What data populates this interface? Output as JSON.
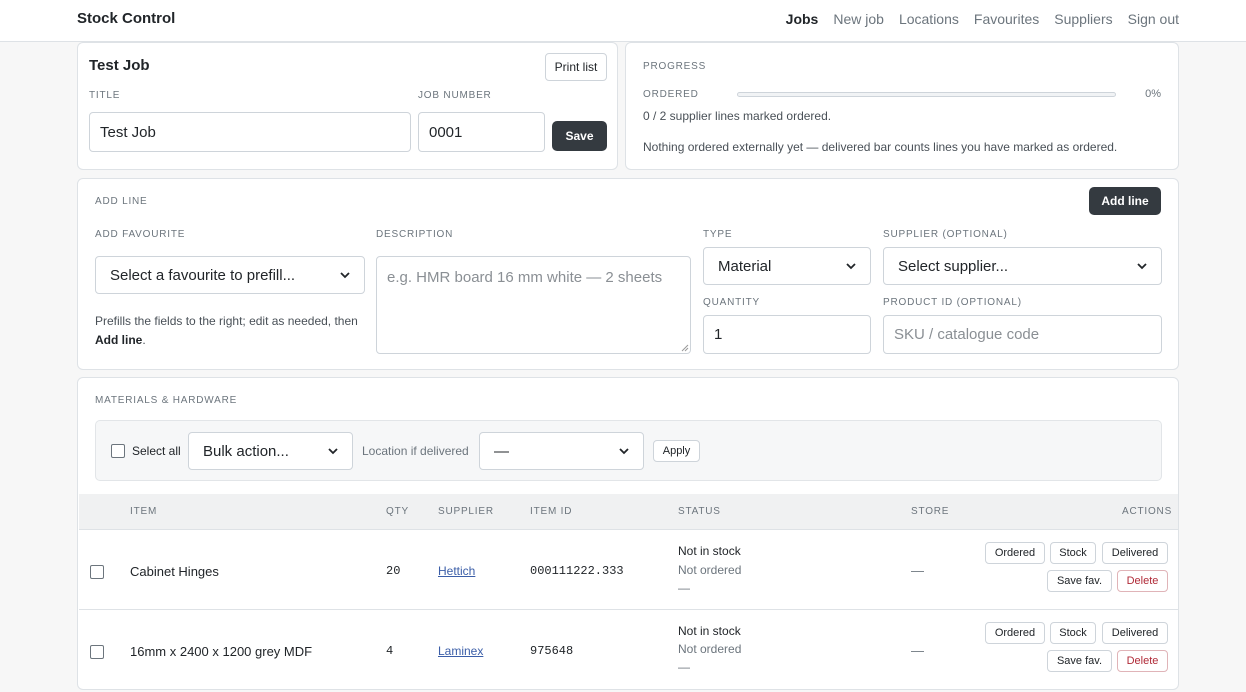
{
  "app": {
    "brand": "Stock Control"
  },
  "nav": {
    "items": [
      {
        "label": "Jobs",
        "active": true
      },
      {
        "label": "New job"
      },
      {
        "label": "Locations"
      },
      {
        "label": "Favourites"
      },
      {
        "label": "Suppliers"
      },
      {
        "label": "Sign out"
      }
    ]
  },
  "job": {
    "heading": "Test Job",
    "print_label": "Print list",
    "title_label": "TITLE",
    "title_value": "Test Job",
    "number_label": "JOB NUMBER",
    "number_value": "0001",
    "save_label": "Save"
  },
  "progress": {
    "heading": "PROGRESS",
    "ordered_label": "ORDERED",
    "ordered_fraction": 0,
    "ordered_percent": "0%",
    "summary": "0 / 2 supplier lines marked ordered.",
    "note": "Nothing ordered externally yet — delivered bar counts lines you have marked as ordered."
  },
  "add_line": {
    "heading": "ADD LINE",
    "button": "Add line",
    "favourite_label": "ADD FAVOURITE",
    "favourite_placeholder": "Select a favourite to prefill...",
    "help_text": "Prefills the fields to the right; edit as needed, then",
    "help_bold": "Add line",
    "help_end": ".",
    "description_label": "DESCRIPTION",
    "description_placeholder": "e.g. HMR board 16 mm white — 2 sheets",
    "type_label": "TYPE",
    "type_value": "Material",
    "supplier_label": "SUPPLIER (OPTIONAL)",
    "supplier_value": "Select supplier...",
    "quantity_label": "QUANTITY",
    "quantity_value": "1",
    "product_label": "PRODUCT ID (OPTIONAL)",
    "product_placeholder": "SKU / catalogue code"
  },
  "materials": {
    "heading": "MATERIALS & HARDWARE",
    "select_all": "Select all",
    "bulk_action": "Bulk action...",
    "location_label": "Location if delivered",
    "location_value": "—",
    "apply": "Apply",
    "columns": {
      "item": "ITEM",
      "qty": "QTY",
      "supplier": "SUPPLIER",
      "item_id": "ITEM ID",
      "status": "STATUS",
      "store": "STORE",
      "actions": "ACTIONS"
    },
    "actions": {
      "ordered": "Ordered",
      "stock": "Stock",
      "delivered": "Delivered",
      "save_fav": "Save fav.",
      "delete": "Delete"
    },
    "rows": [
      {
        "item": "Cabinet Hinges",
        "qty": "20",
        "supplier": "Hettich",
        "item_id": "000111222.333",
        "status1": "Not in stock",
        "status2": "Not ordered",
        "status3": "—",
        "store": "—"
      },
      {
        "item": "16mm x 2400 x 1200 grey MDF",
        "qty": "4",
        "supplier": "Laminex",
        "item_id": "975648",
        "status1": "Not in stock",
        "status2": "Not ordered",
        "status3": "—",
        "store": "—"
      }
    ]
  }
}
